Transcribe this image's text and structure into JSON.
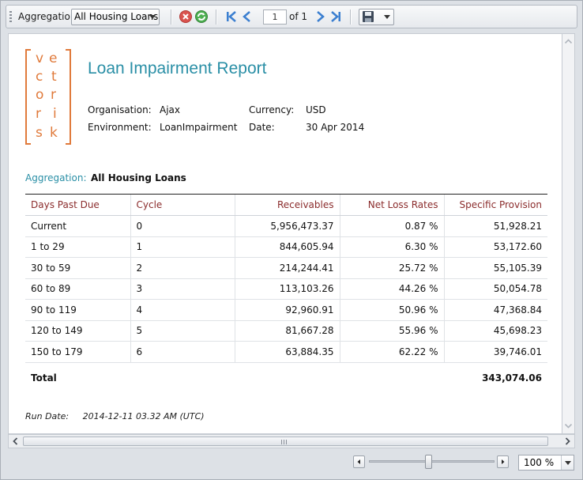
{
  "toolbar": {
    "aggregation_label": "Aggregation:",
    "aggregation_selected": "All Housing Loans",
    "page_current": "1",
    "page_of": "of 1"
  },
  "report": {
    "logo_letters": [
      [
        "v",
        "e"
      ],
      [
        "c",
        "t"
      ],
      [
        "o",
        "r"
      ],
      [
        "r",
        "i"
      ],
      [
        "s",
        "k"
      ]
    ],
    "title": "Loan Impairment Report",
    "meta": {
      "organisation_label": "Organisation:",
      "organisation_value": "Ajax",
      "environment_label": "Environment:",
      "environment_value": "LoanImpairment",
      "currency_label": "Currency:",
      "currency_value": "USD",
      "date_label": "Date:",
      "date_value": "30 Apr 2014"
    },
    "aggregation_label": "Aggregation:",
    "aggregation_value": "All Housing Loans",
    "table": {
      "headers": [
        "Days Past Due",
        "Cycle",
        "Receivables",
        "Net Loss Rates",
        "Specific Provision"
      ],
      "rows": [
        [
          "Current",
          "0",
          "5,956,473.37",
          "0.87 %",
          "51,928.21"
        ],
        [
          "1 to 29",
          "1",
          "844,605.94",
          "6.30 %",
          "53,172.60"
        ],
        [
          "30 to 59",
          "2",
          "214,244.41",
          "25.72 %",
          "55,105.39"
        ],
        [
          "60 to 89",
          "3",
          "113,103.26",
          "44.26 %",
          "50,054.78"
        ],
        [
          "90 to 119",
          "4",
          "92,960.91",
          "50.96 %",
          "47,368.84"
        ],
        [
          "120 to 149",
          "5",
          "81,667.28",
          "55.96 %",
          "45,698.23"
        ],
        [
          "150 to 179",
          "6",
          "63,884.35",
          "62.22 %",
          "39,746.01"
        ]
      ],
      "total_label": "Total",
      "total_value": "343,074.06"
    },
    "run_date_label": "Run Date:",
    "run_date_value": "2014-12-11 03.32 AM (UTC)"
  },
  "zoom": {
    "level": "100 %",
    "slider_fraction": 0.47
  },
  "colors": {
    "accent_teal": "#2a8fa6",
    "logo_orange": "#e07a3b",
    "header_red": "#8b2c2c"
  }
}
